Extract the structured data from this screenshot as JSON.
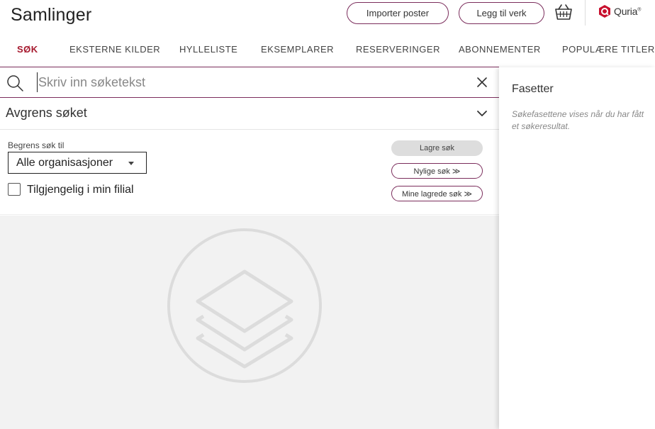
{
  "header": {
    "title": "Samlinger",
    "import_label": "Importer poster",
    "add_label": "Legg til verk",
    "logo_text": "Quria",
    "logo_reg": "®"
  },
  "tabs": [
    {
      "label": "SØK",
      "active": true
    },
    {
      "label": "EKSTERNE KILDER",
      "active": false
    },
    {
      "label": "HYLLELISTE",
      "active": false
    },
    {
      "label": "EKSEMPLARER",
      "active": false
    },
    {
      "label": "RESERVERINGER",
      "active": false
    },
    {
      "label": "ABONNEMENTER",
      "active": false
    },
    {
      "label": "POPULÆRE TITLER",
      "active": false
    }
  ],
  "search": {
    "placeholder": "Skriv inn søketekst",
    "value": ""
  },
  "refine": {
    "title": "Avgrens søket",
    "limit_label": "Begrens søk til",
    "selected_org": "Alle organisasjoner",
    "checkbox_label": "Tilgjengelig i min filial",
    "checkbox_checked": false,
    "save_label": "Lagre søk",
    "recent_label": "Nylige søk ≫",
    "mine_label": "Mine lagrede søk ≫"
  },
  "facets": {
    "title": "Fasetter",
    "note": "Søkefasettene vises når du har fått et søkeresultat."
  },
  "icons": {
    "search": "search-icon",
    "clear": "close-icon",
    "chevron": "chevron-down-icon",
    "basket": "basket-icon",
    "empty": "layers-icon",
    "logo": "quria-logo-icon"
  },
  "colors": {
    "accent": "#7b2d5c",
    "active_tab": "#a6192e",
    "empty_bg": "#f2f2f2"
  }
}
